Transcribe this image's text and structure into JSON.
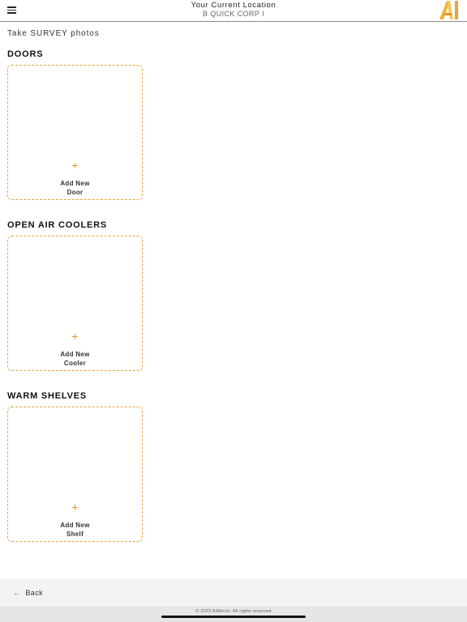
{
  "header": {
    "location_title": "Your Current Location",
    "location_name": "B QUICK CORP I",
    "menu_icon": "hamburger-menu-icon",
    "logo": "aimerch-logo",
    "brand_color": "#e2962b"
  },
  "intro_text": "Take SURVEY photos",
  "sections": [
    {
      "title": "DOORS",
      "add_line1": "Add New",
      "add_line2": "Door",
      "add_icon": "plus-icon"
    },
    {
      "title": "OPEN AIR COOLERS",
      "add_line1": "Add New",
      "add_line2": "Cooler",
      "add_icon": "plus-icon"
    },
    {
      "title": "WARM SHELVES",
      "add_line1": "Add New",
      "add_line2": "Shelf",
      "add_icon": "plus-icon"
    }
  ],
  "footer": {
    "back_label": "Back",
    "back_icon": "arrow-left-icon",
    "copyright": "© 2023 AIMerch. All rights reserved"
  }
}
